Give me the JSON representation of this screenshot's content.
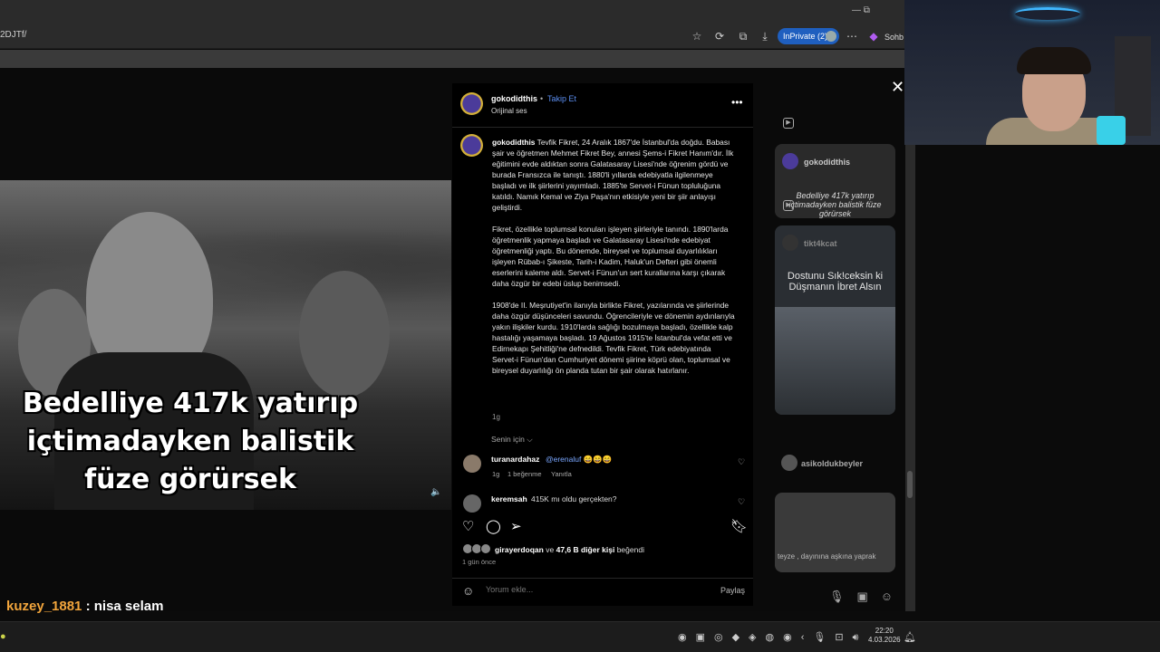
{
  "browser": {
    "url": "2DJTf/",
    "inprivate_label": "InPrivate (2)",
    "copilot_label": "Sohb",
    "window_controls": "—   ⧉",
    "icons": [
      "favorite-star-icon",
      "extensions-icon",
      "collections-icon",
      "downloads-icon",
      "more-icon"
    ]
  },
  "post": {
    "username": "gokodidthis",
    "separator": "•",
    "follow_label": "Takip Et",
    "audio": "Orijinal ses",
    "caption_user": "gokodidthis",
    "caption_p1": "Tevfik Fikret, 24 Aralık 1867'de İstanbul'da doğdu. Babası şair ve öğretmen Mehmet Fikret Bey, annesi Şems-i Fikret Hanım'dır. İlk eğitimini evde aldıktan sonra Galatasaray Lisesi'nde öğrenim gördü ve burada Fransızca ile tanıştı. 1880'li yıllarda edebiyatla ilgilenmeye başladı ve ilk şiirlerini yayımladı. 1885'te Servet-i Fünun topluluğuna katıldı. Namık Kemal ve Ziya Paşa'nın etkisiyle yeni bir şiir anlayışı geliştirdi.",
    "caption_p2": "Fikret, özellikle toplumsal konuları işleyen şiirleriyle tanındı. 1890'larda öğretmenlik yapmaya başladı ve Galatasaray Lisesi'nde edebiyat öğretmenliği yaptı. Bu dönemde, bireysel ve toplumsal duyarlılıkları işleyen Rübab-ı Şikeste, Tarih-i Kadim, Haluk'un Defteri gibi önemli eserlerini kaleme aldı. Servet-i Fünun'un sert kurallarına karşı çıkarak daha özgür bir edebi üslup benimsedi.",
    "caption_p3": "1908'de II. Meşrutiyet'in ilanıyla birlikte Fikret, yazılarında ve şiirlerinde daha özgür düşünceleri savundu. Öğrencileriyle ve dönemin aydınlarıyla yakın ilişkiler kurdu. 1910'larda sağlığı bozulmaya başladı, özellikle kalp hastalığı yaşamaya başladı. 19 Ağustos 1915'te İstanbul'da vefat etti ve Edirnekapı Şehitliği'ne defnedildi. Tevfik Fikret, Türk edebiyatında Servet-i Fünun'dan Cumhuriyet dönemi şiirine köprü olan, toplumsal ve bireysel duyarlılığı ön planda tutan bir şair olarak hatırlanır.",
    "caption_time": "1g",
    "sort_label": "Senin için ⌵",
    "comments": [
      {
        "user": "turanardahaz",
        "mention": "@erenaluf",
        "text": "😄😄😄",
        "time": "1g",
        "likes": "1 beğenme",
        "reply": "Yanıtla"
      },
      {
        "user": "keremsah",
        "mention": "",
        "text": "415K mı oldu gerçekten?"
      }
    ],
    "likes_prefix": "ve",
    "liker": "girayerdoqan",
    "likes_rest": "47,6 B diğer kişi",
    "likes_suffix": "beğendi",
    "ago": "1 gün önce",
    "comment_placeholder": "Yorum ekle...",
    "share_label": "Paylaş"
  },
  "video": {
    "caption": "Bedelliye 417k yatırıp içtimadayken balistik füze görürsek"
  },
  "suggestions": [
    {
      "user": "gokodidthis",
      "caption": "Bedelliye 417k yatırıp içtimadayken balistik füze görürsek"
    },
    {
      "user": "tikt4kcat",
      "caption": "Dostunu Sık!ceksin ki Düşmanın İbret Alsın"
    },
    {
      "user": "asikoldukbeyler",
      "caption": "teyze , dayınına aşkına yaprak"
    }
  ],
  "stream_chat": {
    "user": "kuzey_1881",
    "sep": " : ",
    "message": "nisa selam"
  },
  "taskbar": {
    "time": "22:20",
    "date": "4.03.2026"
  },
  "colors": {
    "accent": "#5b8ef0",
    "inprivate": "#1f5fbf",
    "chat_user": "#f2a53c"
  }
}
